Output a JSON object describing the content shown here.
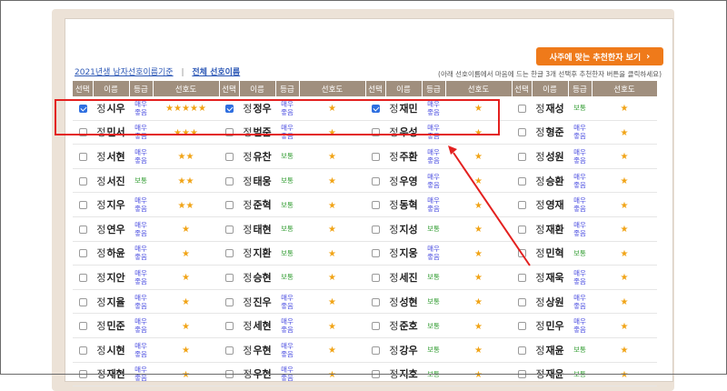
{
  "recommend_button": "사주에 맞는 추천한자 보기",
  "link_2021": "2021년생 남자선호이름기준",
  "link_sep": "|",
  "link_all": "전체 선호이름",
  "note": "(아래 선호이름에서 마음에 드는 한글 3개 선택후 추천한자 버튼을 클릭하세요)",
  "headers": [
    "선택",
    "이름",
    "등급",
    "선호도"
  ],
  "grade_labels": {
    "vg": "매우 좋음",
    "n": "보통"
  },
  "colors": {
    "header": "#a08f7e",
    "button": "#ef7a1a",
    "highlight": "#e3201f",
    "checked": "#2f6fe0"
  },
  "columns": [
    [
      {
        "sur": "정",
        "giv": "시우",
        "grade": "vg",
        "stars": "★★★★★",
        "checked": true
      },
      {
        "sur": "정",
        "giv": "민서",
        "grade": "vg",
        "stars": "★★★",
        "checked": false
      },
      {
        "sur": "정",
        "giv": "서현",
        "grade": "vg",
        "stars": "★★",
        "checked": false
      },
      {
        "sur": "정",
        "giv": "서진",
        "grade": "n",
        "stars": "★★",
        "checked": false
      },
      {
        "sur": "정",
        "giv": "지우",
        "grade": "vg",
        "stars": "★★",
        "checked": false
      },
      {
        "sur": "정",
        "giv": "연우",
        "grade": "vg",
        "stars": "★",
        "checked": false
      },
      {
        "sur": "정",
        "giv": "하윤",
        "grade": "vg",
        "stars": "★",
        "checked": false
      },
      {
        "sur": "정",
        "giv": "지안",
        "grade": "vg",
        "stars": "★",
        "checked": false
      },
      {
        "sur": "정",
        "giv": "지율",
        "grade": "vg",
        "stars": "★",
        "checked": false
      },
      {
        "sur": "정",
        "giv": "민준",
        "grade": "vg",
        "stars": "★",
        "checked": false
      },
      {
        "sur": "정",
        "giv": "시현",
        "grade": "vg",
        "stars": "★",
        "checked": false
      },
      {
        "sur": "정",
        "giv": "재현",
        "grade": "vg",
        "stars": "★",
        "checked": false
      }
    ],
    [
      {
        "sur": "정",
        "giv": "정우",
        "grade": "vg",
        "stars": "★",
        "checked": true
      },
      {
        "sur": "정",
        "giv": "범준",
        "grade": "vg",
        "stars": "★",
        "checked": false
      },
      {
        "sur": "정",
        "giv": "유찬",
        "grade": "n",
        "stars": "★",
        "checked": false
      },
      {
        "sur": "정",
        "giv": "태웅",
        "grade": "n",
        "stars": "★",
        "checked": false
      },
      {
        "sur": "정",
        "giv": "준혁",
        "grade": "n",
        "stars": "★",
        "checked": false
      },
      {
        "sur": "정",
        "giv": "태현",
        "grade": "n",
        "stars": "★",
        "checked": false
      },
      {
        "sur": "정",
        "giv": "지환",
        "grade": "n",
        "stars": "★",
        "checked": false
      },
      {
        "sur": "정",
        "giv": "승현",
        "grade": "n",
        "stars": "★",
        "checked": false
      },
      {
        "sur": "정",
        "giv": "진우",
        "grade": "vg",
        "stars": "★",
        "checked": false
      },
      {
        "sur": "정",
        "giv": "세현",
        "grade": "vg",
        "stars": "★",
        "checked": false
      },
      {
        "sur": "정",
        "giv": "우현",
        "grade": "vg",
        "stars": "★",
        "checked": false
      },
      {
        "sur": "정",
        "giv": "우현",
        "grade": "vg",
        "stars": "★",
        "checked": false
      }
    ],
    [
      {
        "sur": "정",
        "giv": "재민",
        "grade": "vg",
        "stars": "★",
        "checked": true
      },
      {
        "sur": "정",
        "giv": "우성",
        "grade": "vg",
        "stars": "★",
        "checked": false
      },
      {
        "sur": "정",
        "giv": "주환",
        "grade": "vg",
        "stars": "★",
        "checked": false
      },
      {
        "sur": "정",
        "giv": "우영",
        "grade": "vg",
        "stars": "★",
        "checked": false
      },
      {
        "sur": "정",
        "giv": "동혁",
        "grade": "vg",
        "stars": "★",
        "checked": false
      },
      {
        "sur": "정",
        "giv": "지성",
        "grade": "n",
        "stars": "★",
        "checked": false
      },
      {
        "sur": "정",
        "giv": "지웅",
        "grade": "vg",
        "stars": "★",
        "checked": false
      },
      {
        "sur": "정",
        "giv": "세진",
        "grade": "n",
        "stars": "★",
        "checked": false
      },
      {
        "sur": "정",
        "giv": "성현",
        "grade": "n",
        "stars": "★",
        "checked": false
      },
      {
        "sur": "정",
        "giv": "준호",
        "grade": "n",
        "stars": "★",
        "checked": false
      },
      {
        "sur": "정",
        "giv": "강우",
        "grade": "n",
        "stars": "★",
        "checked": false
      },
      {
        "sur": "정",
        "giv": "지호",
        "grade": "n",
        "stars": "★",
        "checked": false
      }
    ],
    [
      {
        "sur": "정",
        "giv": "재성",
        "grade": "n",
        "stars": "★",
        "checked": false
      },
      {
        "sur": "정",
        "giv": "형준",
        "grade": "vg",
        "stars": "★",
        "checked": false
      },
      {
        "sur": "정",
        "giv": "성원",
        "grade": "vg",
        "stars": "★",
        "checked": false
      },
      {
        "sur": "정",
        "giv": "승환",
        "grade": "vg",
        "stars": "★",
        "checked": false
      },
      {
        "sur": "정",
        "giv": "영재",
        "grade": "vg",
        "stars": "★",
        "checked": false
      },
      {
        "sur": "정",
        "giv": "재환",
        "grade": "vg",
        "stars": "★",
        "checked": false
      },
      {
        "sur": "정",
        "giv": "민혁",
        "grade": "n",
        "stars": "★",
        "checked": false
      },
      {
        "sur": "정",
        "giv": "재욱",
        "grade": "vg",
        "stars": "★",
        "checked": false
      },
      {
        "sur": "정",
        "giv": "상원",
        "grade": "vg",
        "stars": "★",
        "checked": false
      },
      {
        "sur": "정",
        "giv": "민우",
        "grade": "vg",
        "stars": "★",
        "checked": false
      },
      {
        "sur": "정",
        "giv": "재윤",
        "grade": "n",
        "stars": "★",
        "checked": false
      },
      {
        "sur": "정",
        "giv": "재윤",
        "grade": "n",
        "stars": "★",
        "checked": false
      }
    ]
  ]
}
